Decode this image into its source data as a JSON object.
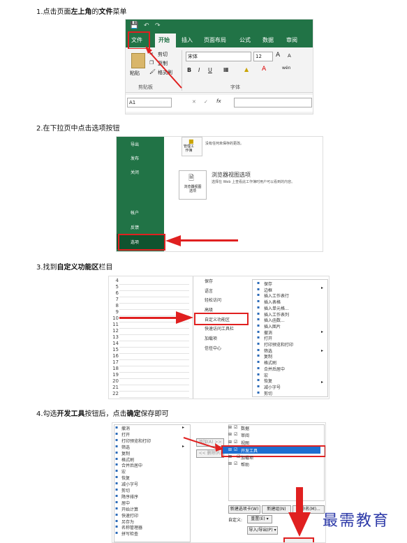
{
  "steps": {
    "s1": {
      "pre": "1.点击页面",
      "b1": "左上角",
      "mid": "的",
      "b2": "文件",
      "post": "菜单"
    },
    "s2": {
      "text": "2.在下拉页中点击选项按钮"
    },
    "s3": {
      "pre": "3.找到",
      "b1": "自定义功能区",
      "post": "栏目"
    },
    "s4": {
      "pre": "4.勾选",
      "b1": "开发工具",
      "mid": "按钮后，点击",
      "b2": "确定",
      "post": "保存即可"
    }
  },
  "excel_ribbon": {
    "tabs": [
      "文件",
      "开始",
      "插入",
      "页面布局",
      "公式",
      "数据",
      "审阅"
    ],
    "cut": "剪切",
    "copy": "复制",
    "paste": "粘贴",
    "format_painter": "格式刷",
    "clipboard_group": "剪贴板",
    "font_group": "字体",
    "font_name": "宋体",
    "font_size": "12",
    "bold": "B",
    "italic": "I",
    "underline": "U",
    "grow_font": "A",
    "shrink_font": "A",
    "wen": "wén",
    "name_box": "A1",
    "fx": "fx"
  },
  "backstage": {
    "side_items": [
      "导出",
      "发布",
      "关闭",
      "帐户",
      "反馈",
      "选项"
    ],
    "manage_wb": "管理工\n作簿",
    "no_changes": "没有任何未保存的更改。",
    "browser_view_btn": "浏览器视图\n选项",
    "browser_view_title": "浏览器视图选项",
    "browser_view_desc": "选择在 Web 上查看此工作簿时用户可以看到的内容。"
  },
  "options_dialog": {
    "rows": [
      "4",
      "5",
      "6",
      "7",
      "8",
      "9",
      "10",
      "11",
      "12",
      "13",
      "14",
      "15",
      "16",
      "17",
      "18",
      "19",
      "20",
      "21",
      "22"
    ],
    "categories": [
      "保存",
      "语言",
      "轻松访问",
      "高级",
      "自定义功能区",
      "快速访问工具栏",
      "加载项",
      "信任中心"
    ],
    "commands": [
      "保存",
      "边框",
      "插入工作表行",
      "插入表格",
      "插入单元格...",
      "插入工作表列",
      "插入函数...",
      "插入图片",
      "撤消",
      "打开",
      "打印预览和打印",
      "筛选",
      "复制",
      "格式刷",
      "合并后居中",
      "宏",
      "恢复",
      "减小字号",
      "剪切"
    ]
  },
  "customize_dialog": {
    "left_commands": [
      "撤消",
      "打开",
      "打印预览和打印",
      "筛选",
      "复制",
      "格式刷",
      "合并后居中",
      "宏",
      "恢复",
      "减小字号",
      "剪切",
      "降序排序",
      "居中",
      "开始计算",
      "快速打印",
      "另存为",
      "名称管理器",
      "拼写检查"
    ],
    "add_button": "添加(A) >>",
    "remove_button": "<< 删除(R)",
    "tree_items": [
      "数据",
      "审阅",
      "视图",
      "开发工具",
      "加载项",
      "帮助"
    ],
    "new_tab_button": "新建选项卡(W)",
    "new_group_button": "新建组(N)",
    "rename_button": "重命名(M)...",
    "customize_label": "自定义:",
    "reset_button": "重置(E) ▾",
    "import_export_button": "导入/导出(P) ▾"
  },
  "watermark": "最需教育"
}
